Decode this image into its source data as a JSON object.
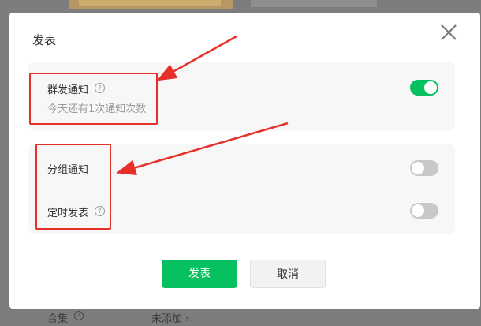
{
  "dialog": {
    "title": "发表",
    "close_icon": "close-icon"
  },
  "group_send": {
    "label": "群发通知",
    "subtext": "今天还有1次通知次数",
    "enabled": true
  },
  "options": [
    {
      "label": "分组通知",
      "enabled": false
    },
    {
      "label": "定时发表",
      "enabled": false
    }
  ],
  "help_glyph": "?",
  "buttons": {
    "publish": "发表",
    "cancel": "取消"
  },
  "background": {
    "bottom_label": "合集",
    "bottom_value": "未添加 ›"
  },
  "colors": {
    "accent": "#07c160",
    "annotation": "#e8302a"
  }
}
